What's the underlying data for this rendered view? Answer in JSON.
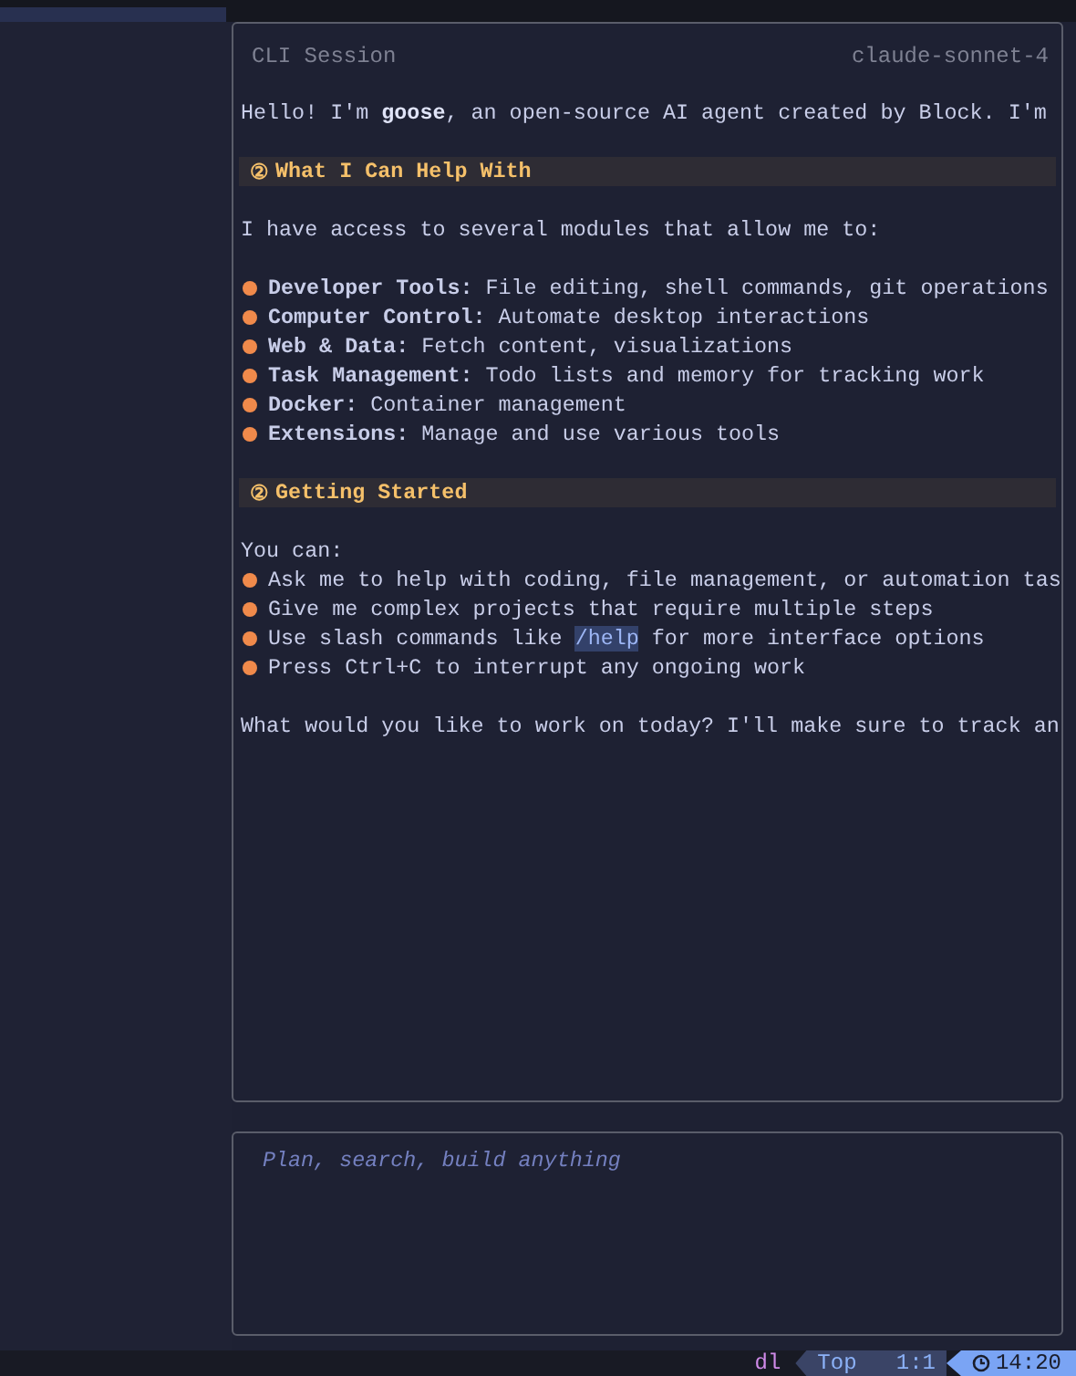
{
  "session": {
    "title": "CLI Session",
    "model": "claude-sonnet-4",
    "blocks": [
      {
        "kind": "para",
        "text": "Hello! I'm **goose**, an open-source AI agent created by Block. I'm"
      },
      {
        "kind": "heading",
        "marker": "②",
        "text": "What I Can Help With"
      },
      {
        "kind": "para",
        "text": "I have access to several modules that allow me to:"
      },
      {
        "kind": "list",
        "items": [
          "**Developer Tools:** File editing, shell commands, git operations",
          "**Computer Control:** Automate desktop interactions",
          "**Web & Data:** Fetch content, visualizations",
          "**Task Management:** Todo lists and memory for tracking work",
          "**Docker:** Container management",
          "**Extensions:** Manage and use various tools"
        ]
      },
      {
        "kind": "heading",
        "marker": "②",
        "text": "Getting Started"
      },
      {
        "kind": "tight",
        "text": "You can:"
      },
      {
        "kind": "list",
        "items": [
          "Ask me to help with coding, file management, or automation tas",
          "Give me complex projects that require multiple steps",
          {
            "before": "Use slash commands like ",
            "code": "/help",
            "after": " for more interface options"
          },
          "Press Ctrl+C to interrupt any ongoing work"
        ]
      },
      {
        "kind": "para",
        "text": "What would you like to work on today? I'll make sure to track an"
      }
    ]
  },
  "input": {
    "placeholder": "Plan, search, build anything"
  },
  "status_bar": {
    "mode": "dl",
    "position": "Top",
    "cursor": "1:1",
    "time": "14:20"
  }
}
